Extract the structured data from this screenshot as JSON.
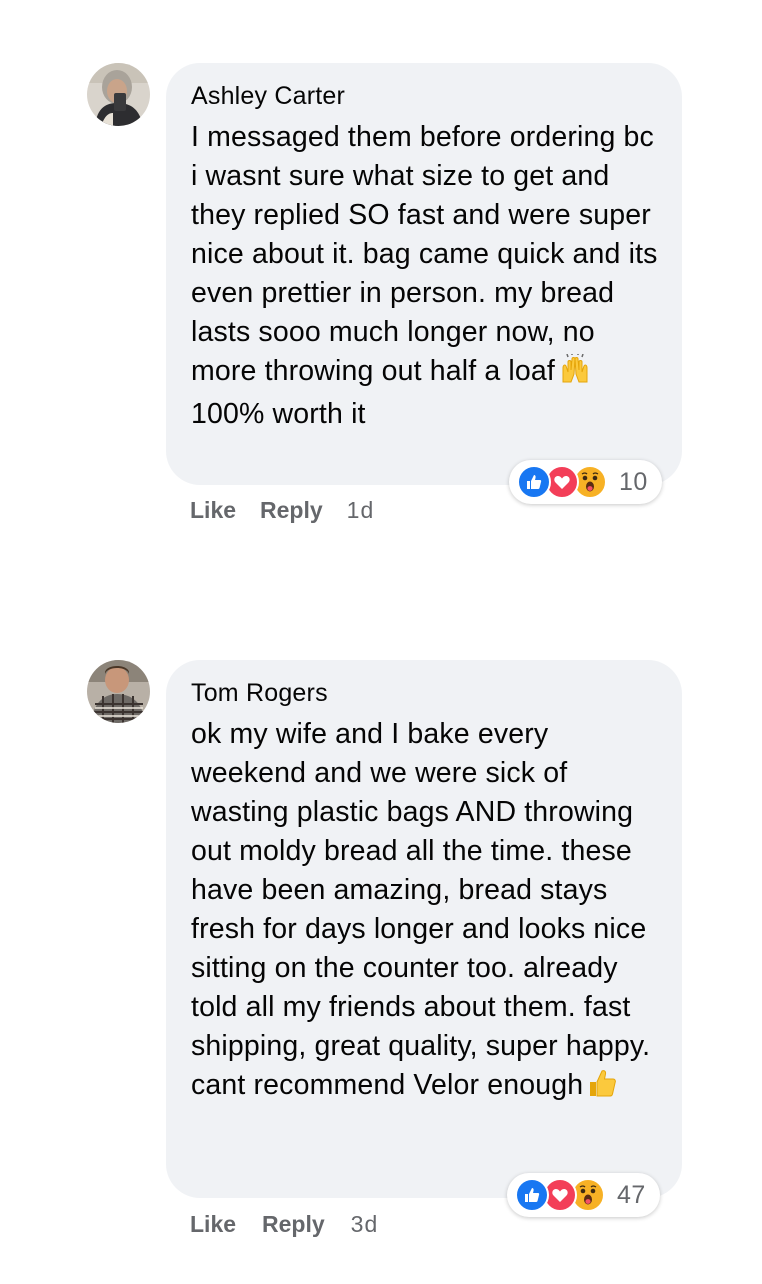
{
  "comments": [
    {
      "author": "Ashley Carter",
      "text": "I messaged them before ordering bc i wasnt sure what size to get and they replied SO fast and were super nice about it. bag came quick and its even prettier in person. my bread lasts sooo much longer now, no more throwing out half a loaf",
      "text_end_emoji": "raising-hands-emoji",
      "text_tail": "100% worth it",
      "reactions": [
        "like",
        "love",
        "wow"
      ],
      "reaction_count": "10",
      "like_label": "Like",
      "reply_label": "Reply",
      "time": "1d"
    },
    {
      "author": "Tom Rogers",
      "text": "ok my wife and I bake every weekend and we were sick of wasting plastic bags AND throwing out moldy bread all the time. these have been amazing, bread stays fresh for days longer and looks nice sitting on the counter too. already told all my friends about them. fast shipping, great quality, super happy. cant recommend Velor enough",
      "text_end_emoji": "thumbs-up-emoji",
      "reactions": [
        "like",
        "love",
        "wow"
      ],
      "reaction_count": "47",
      "like_label": "Like",
      "reply_label": "Reply",
      "time": "3d"
    }
  ],
  "colors": {
    "bubble": "#f0f2f5",
    "secondary_text": "#65676b",
    "like_blue": "#1877f2",
    "love_red": "#f33e58",
    "wow_yellow": "#f7b125"
  }
}
